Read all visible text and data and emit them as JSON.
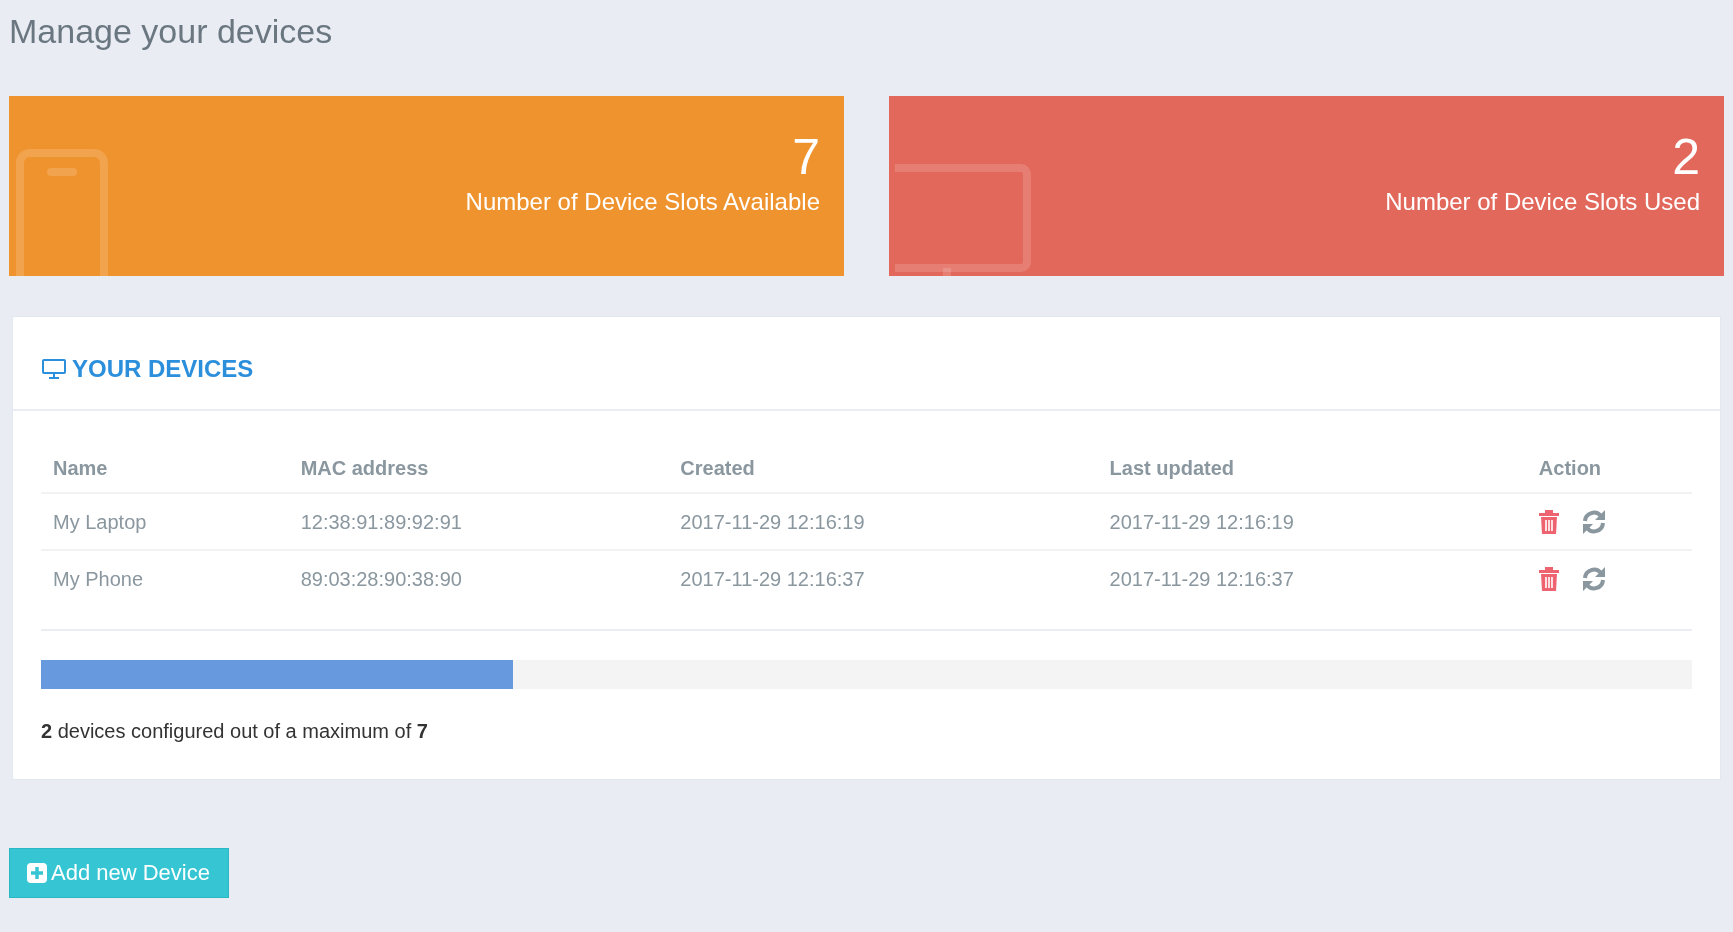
{
  "page_title": "Manage your devices",
  "stat_cards": [
    {
      "kind": "phone",
      "color": "#ef932e",
      "value": "7",
      "label": "Number of Device Slots Available"
    },
    {
      "kind": "monitor",
      "color": "#e2685c",
      "value": "2",
      "label": "Number of Device Slots Used"
    }
  ],
  "devices_panel": {
    "title": "YOUR DEVICES",
    "table": {
      "columns": [
        "Name",
        "MAC address",
        "Created",
        "Last updated",
        "Action"
      ],
      "rows": [
        {
          "name": "My Laptop",
          "mac": "12:38:91:89:92:91",
          "created": "2017-11-29 12:16:19",
          "updated": "2017-11-29 12:16:19"
        },
        {
          "name": "My Phone",
          "mac": "89:03:28:90:38:90",
          "created": "2017-11-29 12:16:37",
          "updated": "2017-11-29 12:16:37"
        }
      ]
    },
    "progress": {
      "level": 0.286
    },
    "summary": "**2** devices configured out of a maximum of **7**"
  },
  "add_button": {
    "label": "Add new Device"
  }
}
